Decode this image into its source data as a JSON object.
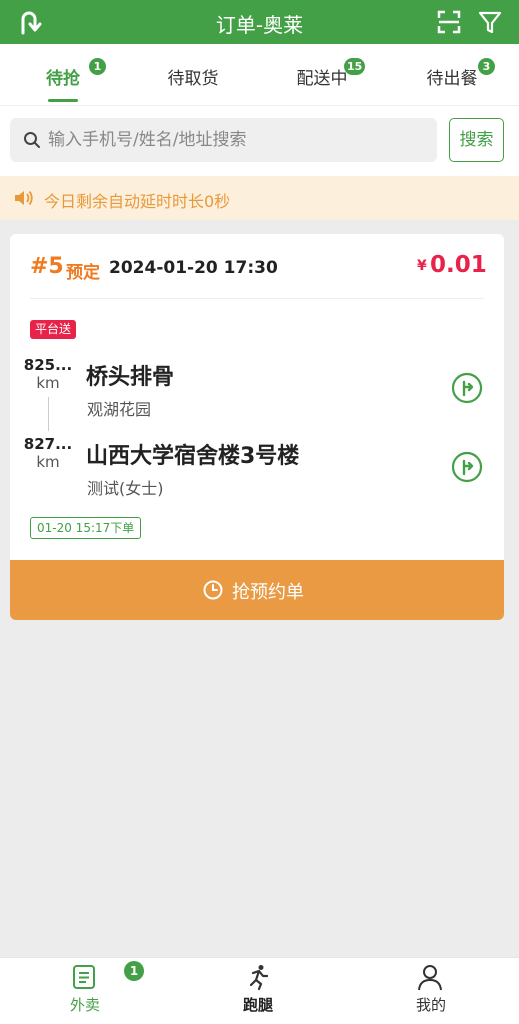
{
  "header": {
    "title": "订单-奥莱"
  },
  "tabs": [
    {
      "label": "待抢",
      "badge": "1"
    },
    {
      "label": "待取货",
      "badge": ""
    },
    {
      "label": "配送中",
      "badge": "15"
    },
    {
      "label": "待出餐",
      "badge": "3"
    }
  ],
  "search": {
    "placeholder": "输入手机号/姓名/地址搜索",
    "button": "搜索"
  },
  "notice": {
    "text": "今日剩余自动延时时长0秒"
  },
  "order": {
    "number": "#5",
    "type": "预定",
    "time": "2024-01-20 17:30",
    "currency": "¥",
    "price": "0.01",
    "tag": "平台送",
    "pickup": {
      "distance": "825...",
      "unit": "km",
      "name": "桥头排骨",
      "address": "观湖花园"
    },
    "dropoff": {
      "distance": "827...",
      "unit": "km",
      "name": "山西大学宿舍楼3号楼",
      "contact": "测试(女士)"
    },
    "placed": "01-20 15:17下单",
    "action": "抢预约单"
  },
  "bottom_nav": [
    {
      "label": "外卖",
      "badge": "1"
    },
    {
      "label": "跑腿"
    },
    {
      "label": "我的"
    }
  ],
  "colors": {
    "primary": "#43a047",
    "accent": "#f07a1f",
    "price": "#e8234a",
    "action": "#e99a43"
  }
}
